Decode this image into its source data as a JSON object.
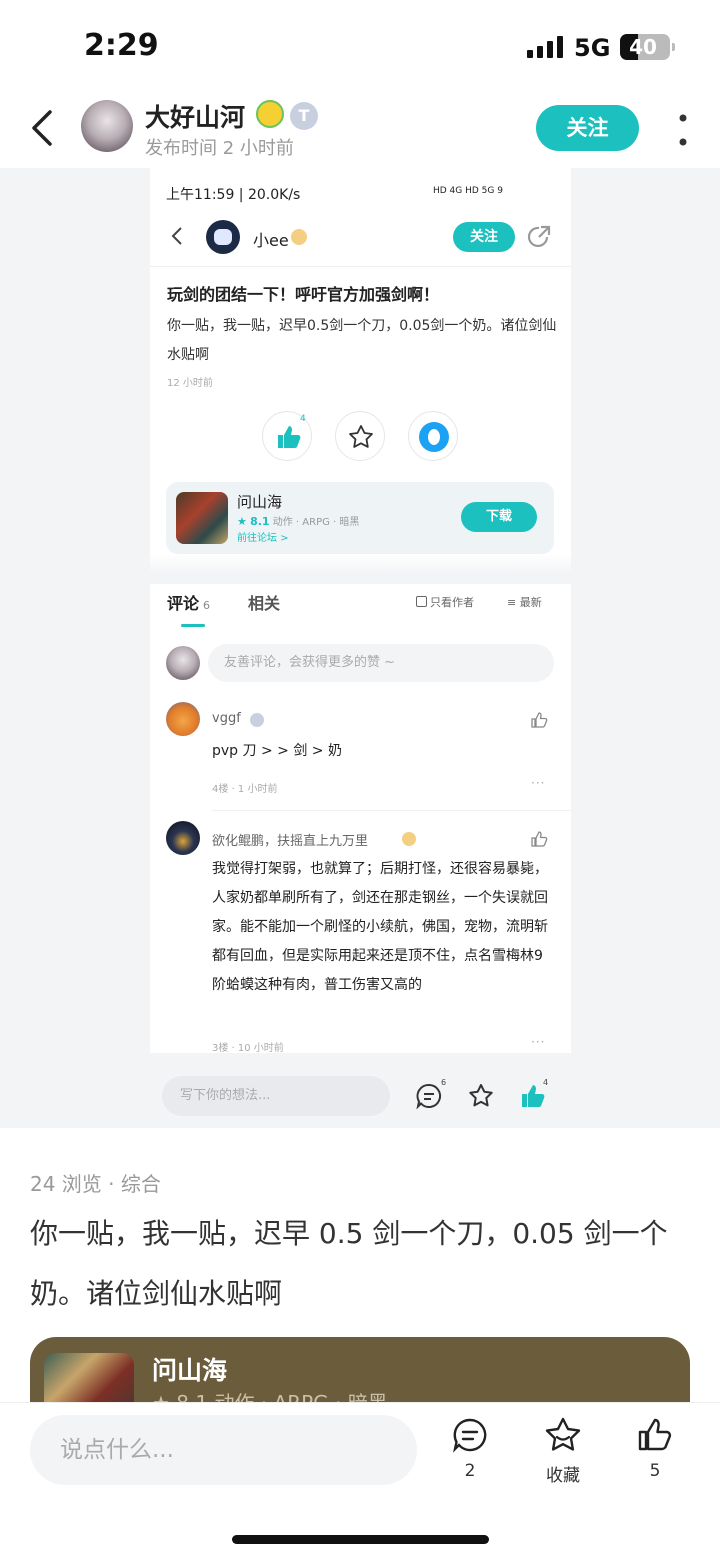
{
  "status": {
    "time": "2:29",
    "network": "5G",
    "battery": "40"
  },
  "header": {
    "author": "大好山河",
    "badge_t": "T",
    "post_time": "发布时间 2 小时前",
    "follow": "关注"
  },
  "screenshot": {
    "statusbar": "上午11:59 | 20.0K/s",
    "statusbar_right": "HD 4G  HD 5G  9",
    "user": "小ee",
    "follow": "关注",
    "title": "玩剑的团结一下！呼吁官方加强剑啊！",
    "body": "你一贴，我一贴，迟早0.5剑一个刀，0.05剑一个奶。诸位剑仙水贴啊",
    "time": "12 小时前",
    "like_count": "4",
    "app": {
      "name": "问山海",
      "rating": "8.1",
      "meta": "动作 · ARPG · 暗黑",
      "link": "前往论坛 >",
      "download": "下载"
    },
    "tabs": {
      "comments": "评论",
      "comments_count": "6",
      "related": "相关",
      "only_author": "只看作者",
      "newest": "最新"
    },
    "comment_placeholder": "友善评论，会获得更多的赞 ~",
    "comments": [
      {
        "name": "vggf",
        "text": "pvp 刀 > > 剑 > 奶",
        "meta": "4楼 · 1 小时前"
      },
      {
        "name": "欲化鲲鹏，扶摇直上九万里",
        "text": "我觉得打架弱，也就算了；后期打怪，还很容易暴毙，人家奶都单刷所有了，剑还在那走钢丝，一个失误就回家。能不能加一个刷怪的小续航，佛国，宠物，流明斩都有回血，但是实际用起来还是顶不住，点名雪梅林9阶蛤蟆这种有肉，普工伤害又高的",
        "meta": "3楼 · 10 小时前"
      }
    ],
    "write_placeholder": "写下你的想法...",
    "comment_sup": "6",
    "like_sup": "4"
  },
  "post": {
    "views": "24 浏览 · 综合",
    "body": "你一贴，我一贴，迟早 0.5 剑一个刀，0.05 剑一个奶。诸位剑仙水贴啊",
    "game": {
      "name": "问山海",
      "meta": "★ 8.1  动作 · ARPG · 暗黑"
    }
  },
  "bottom": {
    "placeholder": "说点什么...",
    "comment_count": "2",
    "collect": "收藏",
    "like_count": "5"
  },
  "colors": {
    "accent": "#1bc0bf",
    "card": "#6b5c3c"
  }
}
